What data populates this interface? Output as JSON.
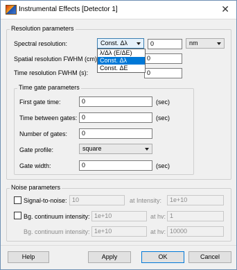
{
  "window": {
    "title": "Instrumental Effects [Detector 1]",
    "close_glyph": "✕"
  },
  "resolution": {
    "group_title": "Resolution parameters",
    "spectral_label": "Spectral resolution:",
    "spectral_mode": "Const. Δλ",
    "spectral_value": "0",
    "unit": "nm",
    "spectral_options": [
      "λ/Δλ (E/ΔE)",
      "Const. Δλ",
      "Const. ΔE"
    ],
    "spatial_label": "Spatial resolution FWHM (cm):",
    "spatial_value": "0",
    "time_label": "Time resolution FWHM (s):",
    "time_value": "0"
  },
  "timegate": {
    "group_title": "Time gate parameters",
    "first_gate_label": "First gate time:",
    "first_gate_value": "0",
    "first_gate_unit": "(sec)",
    "between_label": "Time between gates:",
    "between_value": "0",
    "between_unit": "(sec)",
    "count_label": "Number of gates:",
    "count_value": "0",
    "profile_label": "Gate profile:",
    "profile_value": "square",
    "width_label": "Gate width:",
    "width_value": "0",
    "width_unit": "(sec)"
  },
  "noise": {
    "group_title": "Noise parameters",
    "snr_label": "Signal-to-noise:",
    "snr_value": "10",
    "at_intensity_label": "at Intensity:",
    "at_intensity_value": "1e+10",
    "bg_label": "Bg. continuum intensity:",
    "bg_value_1": "1e+10",
    "at_hv_label_1": "at hv:",
    "at_hv_value_1": "1",
    "bg_label_2": "Bg. continuum intensity:",
    "bg_value_2": "1e+10",
    "at_hv_label_2": "at hv:",
    "at_hv_value_2": "10000"
  },
  "buttons": {
    "help": "Help",
    "apply": "Apply",
    "ok": "OK",
    "cancel": "Cancel"
  }
}
